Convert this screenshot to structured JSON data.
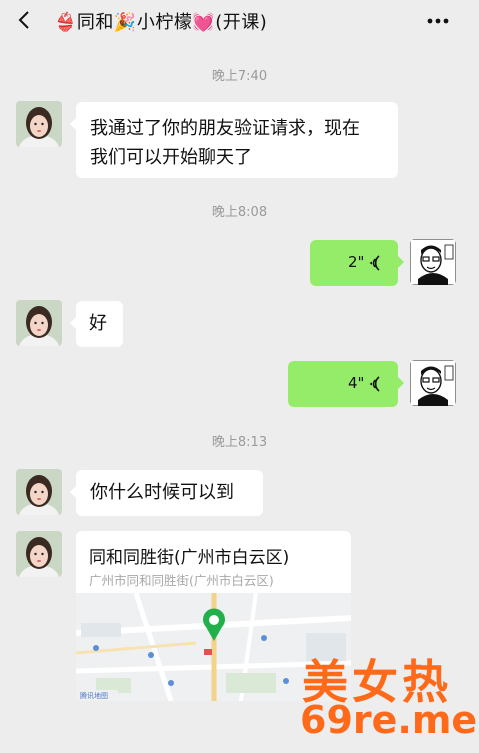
{
  "header": {
    "title": "👙同和🎉小柠檬💓(开课)",
    "back_icon": "chevron-left-icon",
    "more_icon": "ellipsis-icon"
  },
  "messages": [
    {
      "type": "timestamp",
      "text": "晚上7:40"
    },
    {
      "type": "text",
      "side": "left",
      "lines": [
        "我通过了你的朋友验证请求，现在",
        "我们可以开始聊天了"
      ]
    },
    {
      "type": "timestamp",
      "text": "晚上8:08"
    },
    {
      "type": "voice",
      "side": "right",
      "duration": "2\""
    },
    {
      "type": "text",
      "side": "left",
      "lines": [
        "好"
      ]
    },
    {
      "type": "voice",
      "side": "right",
      "duration": "4\""
    },
    {
      "type": "timestamp",
      "text": "晚上8:13"
    },
    {
      "type": "text",
      "side": "left",
      "lines": [
        "你什么时候可以到"
      ]
    },
    {
      "type": "location",
      "side": "left",
      "title": "同和同胜街(广州市白云区)",
      "address": "广州市同和同胜街(广州市白云区)",
      "map_logo": "腾讯地图"
    }
  ],
  "watermark": {
    "line1": "美女热",
    "line2": "69re.me",
    "color": "#ff6a1a"
  },
  "colors": {
    "background": "#ededed",
    "bubble_self": "#95ec69",
    "bubble_other": "#ffffff",
    "timestamp": "#9a9a9a"
  }
}
